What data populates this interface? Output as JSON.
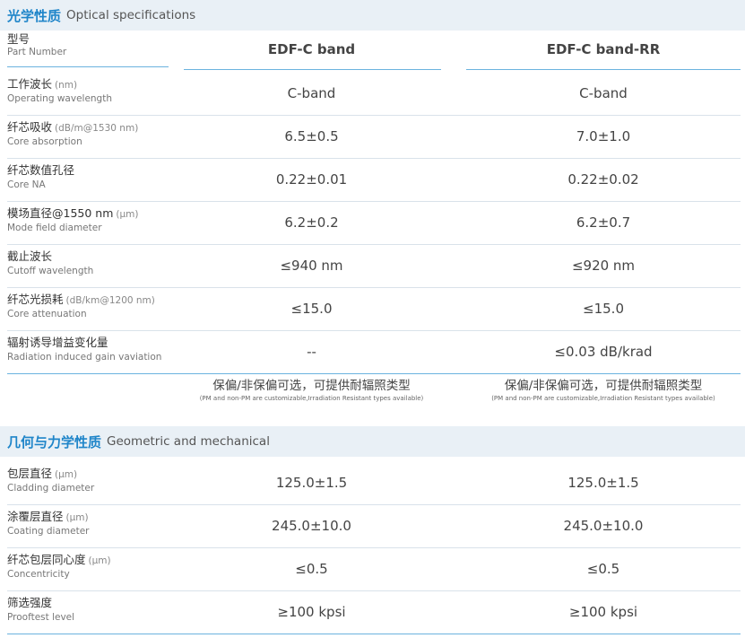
{
  "optical": {
    "title_zh": "光学性质",
    "title_en": "Optical specifications",
    "header": {
      "label_zh": "型号",
      "label_en": "Part Number",
      "col1": "EDF-C band",
      "col2": "EDF-C band-RR"
    },
    "rows": [
      {
        "zh": "工作波长",
        "unit": "(nm)",
        "en": "Operating wavelength",
        "v1": "C-band",
        "v2": "C-band"
      },
      {
        "zh": "纤芯吸收",
        "unit": "(dB/m@1530 nm)",
        "en": "Core absorption",
        "v1": "6.5±0.5",
        "v2": "7.0±1.0"
      },
      {
        "zh": "纤芯数值孔径",
        "unit": "",
        "en": "Core NA",
        "v1": "0.22±0.01",
        "v2": "0.22±0.02"
      },
      {
        "zh": "模场直径@1550 nm",
        "unit": "(μm)",
        "en": "Mode field diameter",
        "v1": "6.2±0.2",
        "v2": "6.2±0.7"
      },
      {
        "zh": "截止波长",
        "unit": "",
        "en": "Cutoff wavelength",
        "v1": "≤940 nm",
        "v2": "≤920 nm"
      },
      {
        "zh": "纤芯光损耗",
        "unit": "(dB/km@1200 nm)",
        "en": "Core attenuation",
        "v1": "≤15.0",
        "v2": "≤15.0"
      },
      {
        "zh": "辐射诱导增益变化量",
        "unit": "",
        "en": "Radiation induced gain vaviation",
        "v1": "--",
        "v2": "≤0.03 dB/krad"
      }
    ],
    "note": {
      "zh": "保偏/非保偏可选，可提供耐辐照类型",
      "en": "(PM and non-PM are customizable,Irradiation Resistant types available)"
    }
  },
  "geometric": {
    "title_zh": "几何与力学性质",
    "title_en": "Geometric and mechanical",
    "rows": [
      {
        "zh": "包层直径",
        "unit": "(μm)",
        "en": "Cladding diameter",
        "v1": "125.0±1.5",
        "v2": "125.0±1.5"
      },
      {
        "zh": "涂覆层直径",
        "unit": "(μm)",
        "en": "Coating diameter",
        "v1": "245.0±10.0",
        "v2": "245.0±10.0"
      },
      {
        "zh": "纤芯包层同心度",
        "unit": "(μm)",
        "en": "Concentricity",
        "v1": "≤0.5",
        "v2": "≤0.5"
      },
      {
        "zh": "筛选强度",
        "unit": "",
        "en": "Prooftest level",
        "v1": "≥100 kpsi",
        "v2": "≥100 kpsi"
      }
    ]
  }
}
